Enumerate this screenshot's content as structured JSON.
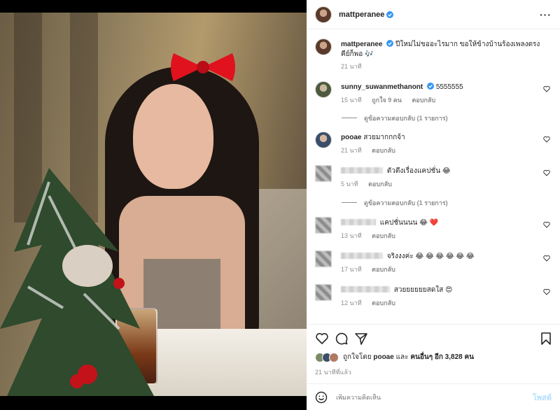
{
  "post": {
    "author": "mattperanee",
    "caption_user": "mattperanee",
    "caption": "ปีใหม่ไม่ขออะไรมาก ขอให้ข้างบ้านร้องเพลงตรงคีย์ก็พอ 🎶",
    "caption_time": "21 นาที"
  },
  "comments": [
    {
      "user": "sunny_suwanmethanont",
      "verified": true,
      "text": "5555555",
      "time": "15 นาที",
      "likes": "ถูกใจ 9 คน",
      "reply": "ตอบกลับ",
      "view_replies": "ดูข้อความตอบกลับ (1 รายการ)"
    },
    {
      "user": "pooae",
      "text": "สวยมากกกจ้า",
      "time": "21 นาที",
      "reply": "ตอบกลับ"
    },
    {
      "user": "",
      "text": "ตัวตึงเรื่องแคปชั่น 😂",
      "time": "5 นาที",
      "reply": "ตอบกลับ",
      "view_replies": "ดูข้อความตอบกลับ (1 รายการ)"
    },
    {
      "user": "",
      "text": "แคปชั่นนนน 😂 ❤️",
      "time": "13 นาที",
      "reply": "ตอบกลับ"
    },
    {
      "user": "",
      "text": "จริงงงค่ะ 😂 😂 😂 😂 😂 😂",
      "time": "17 นาที",
      "reply": "ตอบกลับ"
    },
    {
      "user": "",
      "text": "สวยยยยยยสดใส 😍",
      "time": "12 นาที",
      "reply": "ตอบกลับ"
    }
  ],
  "likes": {
    "prefix": "ถูกใจโดย",
    "user": "pooae",
    "middle": "และ",
    "others": "คนอื่นๆ อีก 3,828 คน"
  },
  "time_ago": "21 นาทีที่แล้ว",
  "add_comment": {
    "placeholder": "เพิ่มความคิดเห็น",
    "post_label": "โพสต์"
  },
  "icons": {
    "more": "more-options-icon",
    "like": "heart-icon",
    "comment": "comment-icon",
    "share": "share-icon",
    "save": "bookmark-icon",
    "emoji": "emoji-icon",
    "verified": "verified-badge-icon"
  },
  "colors": {
    "verified": "#3897f0",
    "post_button": "#b2dffc",
    "secondary_text": "#8e8e8e"
  }
}
